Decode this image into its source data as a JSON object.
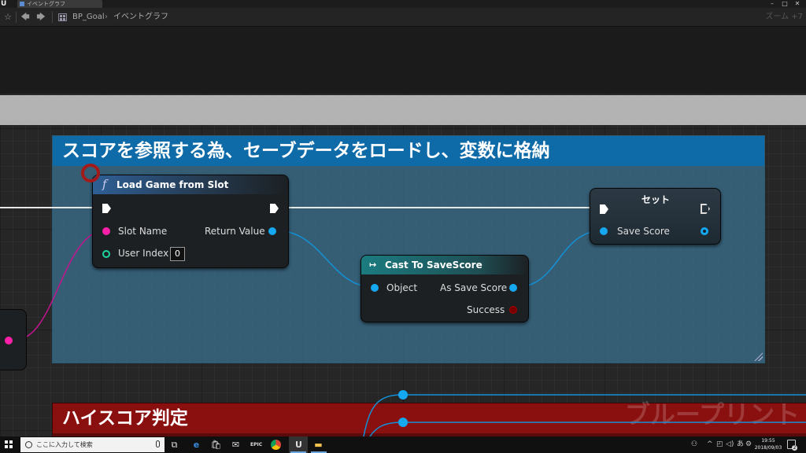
{
  "window": {
    "tab_label": "イベントグラフ",
    "logo": "U"
  },
  "nav": {
    "breadcrumb_root": "BP_Goal",
    "breadcrumb_sep": "›",
    "breadcrumb_current": "イベントグラフ",
    "zoom": "ズーム +7"
  },
  "comments": {
    "main_title": "スコアを参照する為、セーブデータをロードし、変数に格納",
    "second_title": "ハイスコア判定"
  },
  "watermark": "ブループリント",
  "nodes": {
    "load_game": {
      "title": "Load Game from Slot",
      "icon": "function-icon",
      "pin_slot_name": "Slot Name",
      "pin_user_index": "User Index",
      "user_index_value": "0",
      "pin_return_value": "Return Value"
    },
    "cast": {
      "title": "Cast To SaveScore",
      "icon": "cast-arrow-icon",
      "pin_object": "Object",
      "pin_as_save_score": "As Save Score",
      "pin_success": "Success"
    },
    "set": {
      "title": "セット",
      "pin_save_score": "Save Score"
    }
  },
  "colors": {
    "string_pin": "#ff1fa8",
    "int_pin": "#1ed6a0",
    "object_pin": "#15a7f0",
    "bool_pin": "#7a0000",
    "comment_blue": "#0f6aa8",
    "comment_red": "#8a0f0f",
    "reroute": "#a31a1a"
  },
  "taskbar": {
    "search_placeholder": "ここに入力して検索",
    "clock_time": "19:55",
    "clock_date": "2018/09/03",
    "apps": [
      "task-view-icon",
      "edge-icon",
      "store-icon",
      "mail-icon",
      "epic-games-icon",
      "chrome-icon",
      "unreal-engine-icon",
      "file-explorer-icon"
    ],
    "epic_label": "EPIC",
    "ime_label": "あ",
    "notification_count": "2"
  }
}
